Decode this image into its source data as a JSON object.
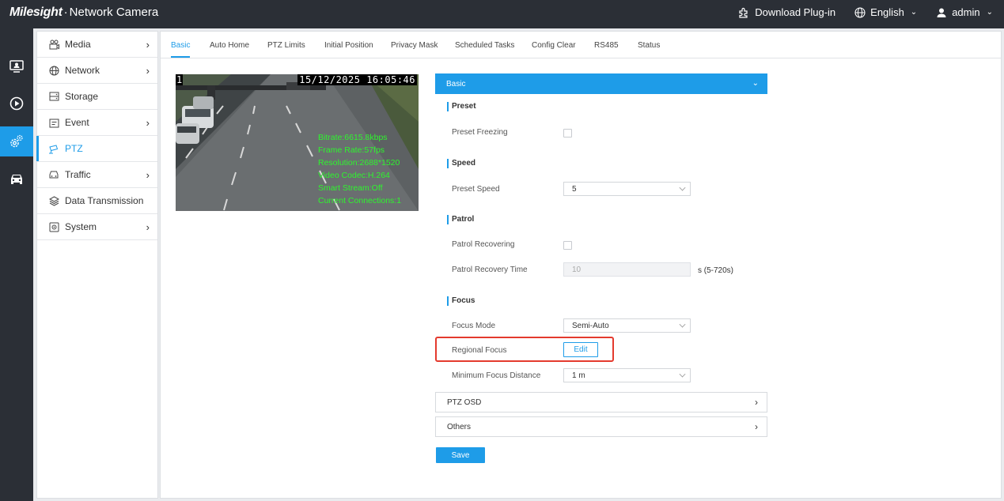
{
  "header": {
    "brand_logo": "Milesight",
    "brand_sep": "·",
    "brand_title": "Network Camera",
    "download_plugin": "Download Plug-in",
    "language": "English",
    "user": "admin"
  },
  "iconbar": {
    "items": [
      "live-view-icon",
      "playback-icon",
      "settings-icon",
      "vehicle-icon"
    ],
    "active": "settings-icon"
  },
  "sidebar": {
    "items": [
      {
        "label": "Media",
        "icon": "media-icon",
        "has_children": true
      },
      {
        "label": "Network",
        "icon": "globe-icon",
        "has_children": true
      },
      {
        "label": "Storage",
        "icon": "storage-icon",
        "has_children": false
      },
      {
        "label": "Event",
        "icon": "event-icon",
        "has_children": true
      },
      {
        "label": "PTZ",
        "icon": "ptz-camera-icon",
        "has_children": false,
        "active": true
      },
      {
        "label": "Traffic",
        "icon": "car-icon",
        "has_children": true
      },
      {
        "label": "Data Transmission",
        "icon": "layers-icon",
        "has_children": false
      },
      {
        "label": "System",
        "icon": "system-icon",
        "has_children": true
      }
    ]
  },
  "tabs": [
    "Basic",
    "Auto Home",
    "PTZ Limits",
    "Initial Position",
    "Privacy Mask",
    "Scheduled Tasks",
    "Config Clear",
    "RS485",
    "Status"
  ],
  "active_tab": "Basic",
  "video": {
    "channel": "1",
    "timestamp": "15/12/2025  16:05:46",
    "info": [
      "Bitrate:6615.8kbps",
      "Frame Rate:57fps",
      "Resolution:2688*1520",
      "Video Codec:H.264",
      "Smart Stream:Off",
      "Current Connections:1"
    ]
  },
  "form": {
    "section_title": "Basic",
    "preset": {
      "title": "Preset",
      "freezing_label": "Preset Freezing",
      "freezing_checked": false
    },
    "speed": {
      "title": "Speed",
      "preset_speed_label": "Preset Speed",
      "preset_speed_value": "5"
    },
    "patrol": {
      "title": "Patrol",
      "recovering_label": "Patrol Recovering",
      "recovering_checked": false,
      "recovery_time_label": "Patrol Recovery Time",
      "recovery_time_value": "10",
      "recovery_time_unit": "s (5-720s)"
    },
    "focus": {
      "title": "Focus",
      "mode_label": "Focus Mode",
      "mode_value": "Semi-Auto",
      "regional_label": "Regional Focus",
      "edit_label": "Edit",
      "min_distance_label": "Minimum Focus Distance",
      "min_distance_value": "1 m"
    },
    "ptz_osd_label": "PTZ OSD",
    "others_label": "Others",
    "save_label": "Save"
  },
  "colors": {
    "accent": "#1e9ce8",
    "topbar": "#2b2f36",
    "highlight": "#e43a2e",
    "osd_text": "#2ef52e"
  }
}
